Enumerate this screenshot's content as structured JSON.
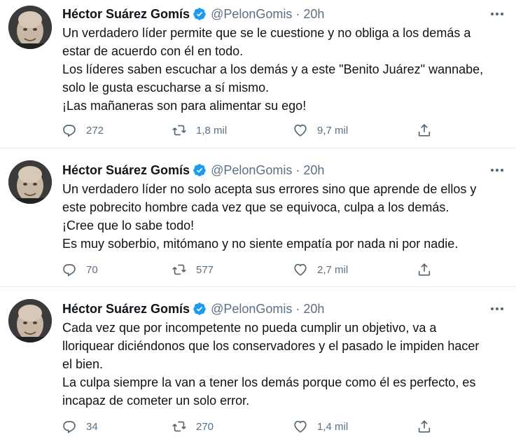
{
  "tweets": [
    {
      "author": {
        "name": "Héctor Suárez Gomís",
        "handle": "@PelonGomis",
        "verified": true,
        "avatar": "avatar"
      },
      "separator": "·",
      "time": "20h",
      "text_lines": [
        "Un verdadero líder permite que se le cuestione y no obliga a los demás a",
        "estar de acuerdo con él en todo.",
        "Los líderes saben escuchar a los demás y a este \"Benito Juárez\" wannabe,",
        "solo le gusta escucharse a sí mismo.",
        "¡Las mañaneras son para alimentar su ego!"
      ],
      "actions": {
        "replies": "272",
        "retweets": "1,8 mil",
        "likes": "9,7 mil"
      }
    },
    {
      "author": {
        "name": "Héctor Suárez Gomís",
        "handle": "@PelonGomis",
        "verified": true,
        "avatar": "avatar"
      },
      "separator": "·",
      "time": "20h",
      "text_lines": [
        "Un verdadero líder no solo acepta sus errores sino que aprende de ellos y",
        "este pobrecito hombre cada vez que se equivoca, culpa a los demás.",
        "¡Cree que lo sabe todo!",
        "Es muy soberbio, mitómano y no siente empatía por nada ni por nadie."
      ],
      "actions": {
        "replies": "70",
        "retweets": "577",
        "likes": "2,7 mil"
      }
    },
    {
      "author": {
        "name": "Héctor Suárez Gomís",
        "handle": "@PelonGomis",
        "verified": true,
        "avatar": "avatar"
      },
      "separator": "·",
      "time": "20h",
      "text_lines": [
        "Cada vez que por incompetente no pueda cumplir un objetivo, va a",
        "lloriquear diciéndonos que los conservadores y el pasado le impiden hacer",
        "el bien.",
        "La culpa siempre la van a tener los demás porque como él es perfecto, es",
        "incapaz de cometer un solo error."
      ],
      "actions": {
        "replies": "34",
        "retweets": "270",
        "likes": "1,4 mil"
      }
    }
  ],
  "colors": {
    "verified": "#1d9bf0",
    "secondary_text": "#5b7083",
    "icon": "#536471",
    "divider": "#e6ecf0"
  },
  "icons": [
    "verified-badge-icon",
    "more-icon",
    "reply-icon",
    "retweet-icon",
    "like-icon",
    "share-icon"
  ]
}
